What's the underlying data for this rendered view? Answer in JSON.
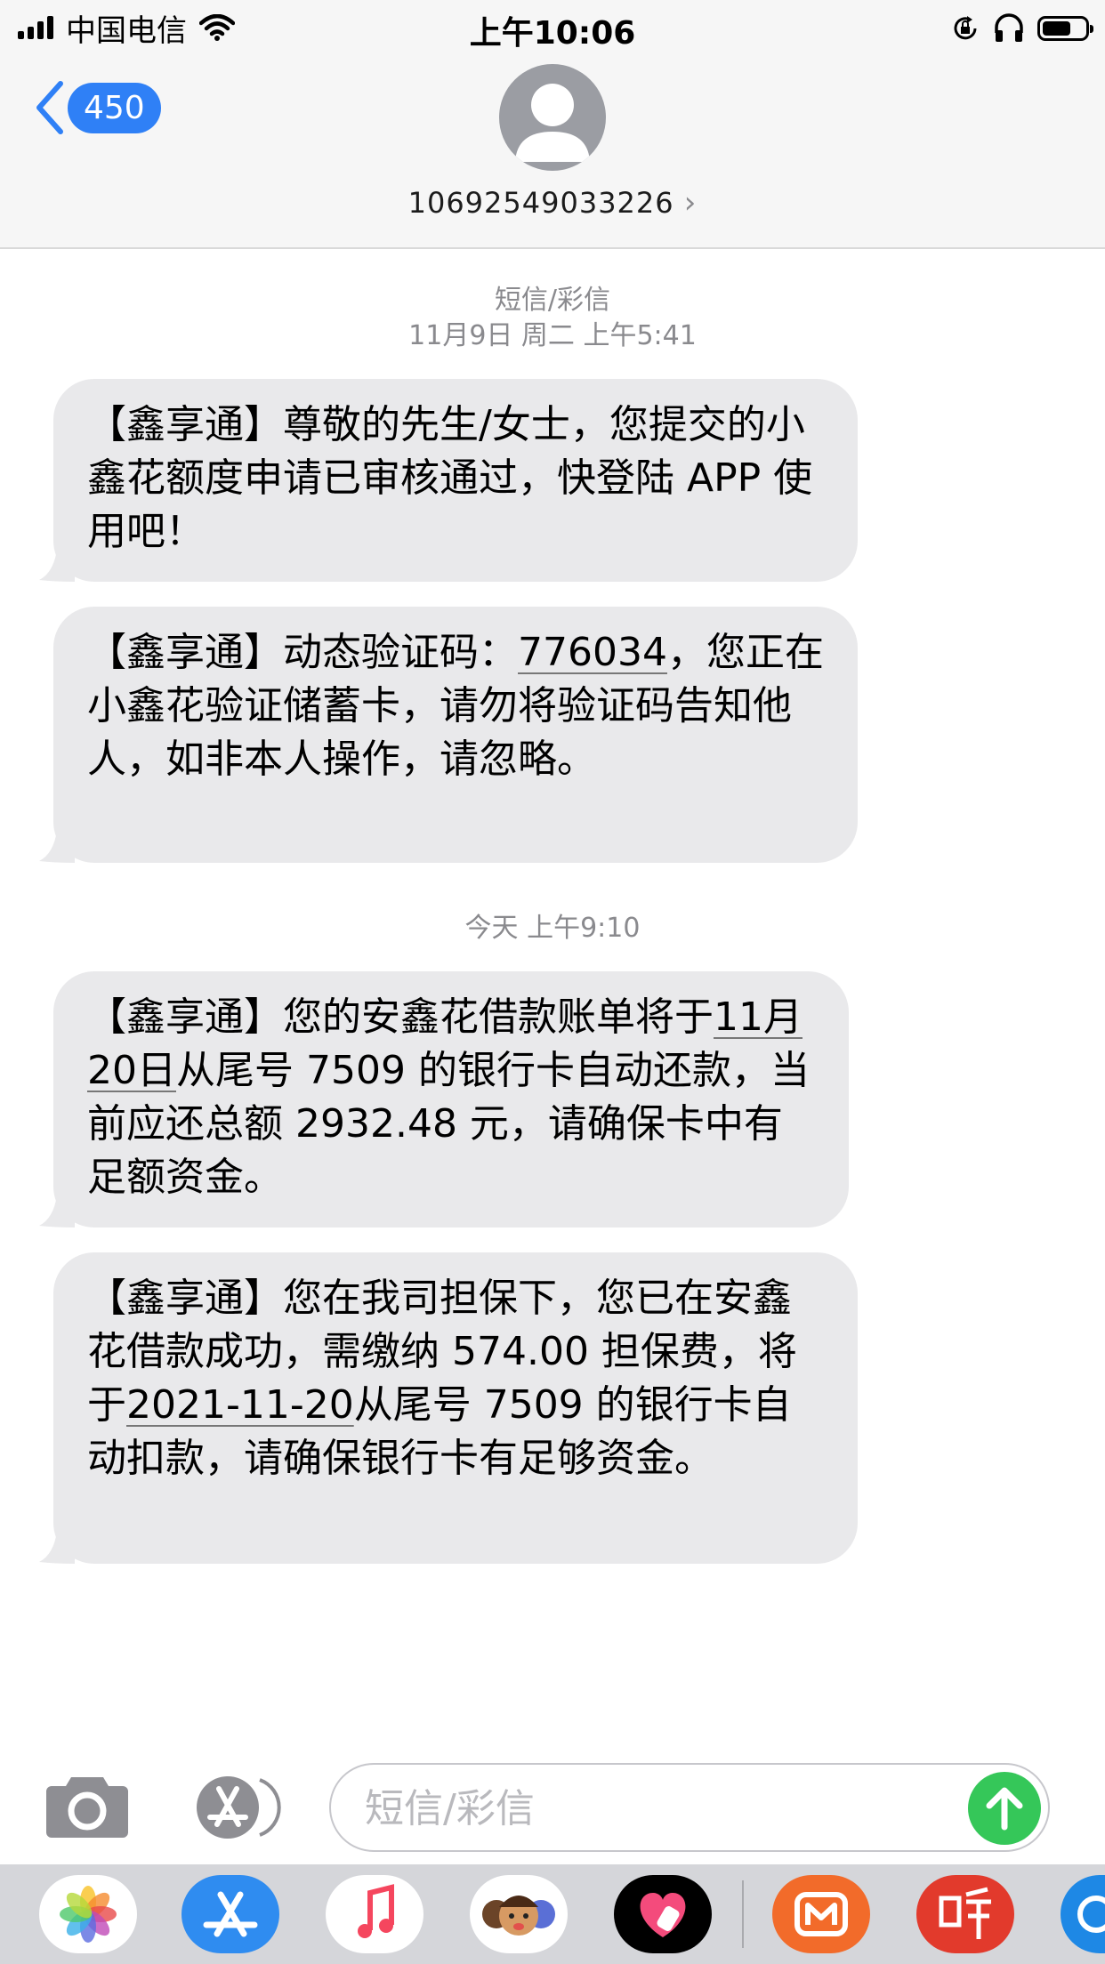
{
  "status_bar": {
    "carrier": "中国电信",
    "time": "上午10:06",
    "battery_level": 0.6
  },
  "header": {
    "back_badge": "450",
    "contact_number": "10692549033226",
    "contact_chevron": "›"
  },
  "messages": {
    "timestamp_1_type": "短信/彩信",
    "timestamp_1_date": "11月9日 周二 上午5:41",
    "bubble_1": "【鑫享通】尊敬的先生/女士，您提交的小鑫花额度申请已审核通过，快登陆 APP 使用吧！",
    "bubble_2": {
      "before": "【鑫享通】动态验证码：",
      "code": "776034",
      "after": "，您正在小鑫花验证储蓄卡，请勿将验证码告知他人，如非本人操作，请忽略。"
    },
    "timestamp_2": "今天 上午9:10",
    "bubble_3": {
      "before": "【鑫享通】您的安鑫花借款账单将于",
      "date": "11月20日",
      "after": "从尾号 7509 的银行卡自动还款，当前应还总额 2932.48 元，请确保卡中有足额资金。"
    },
    "bubble_4": {
      "before": "【鑫享通】您在我司担保下，您已在安鑫花借款成功，需缴纳 574.00 担保费，将于",
      "date": "2021-11-20",
      "after": "从尾号 7509 的银行卡自动扣款，请确保银行卡有足够资金。"
    }
  },
  "input_bar": {
    "placeholder": "短信/彩信"
  },
  "icons": {
    "camera": "camera-icon",
    "app_store": "app-store-icon",
    "send": "send-arrow-icon",
    "back": "chevron-left-icon"
  },
  "colors": {
    "accent_blue": "#2f80f6",
    "bubble_gray": "#e9e9eb",
    "send_green": "#35c759"
  }
}
